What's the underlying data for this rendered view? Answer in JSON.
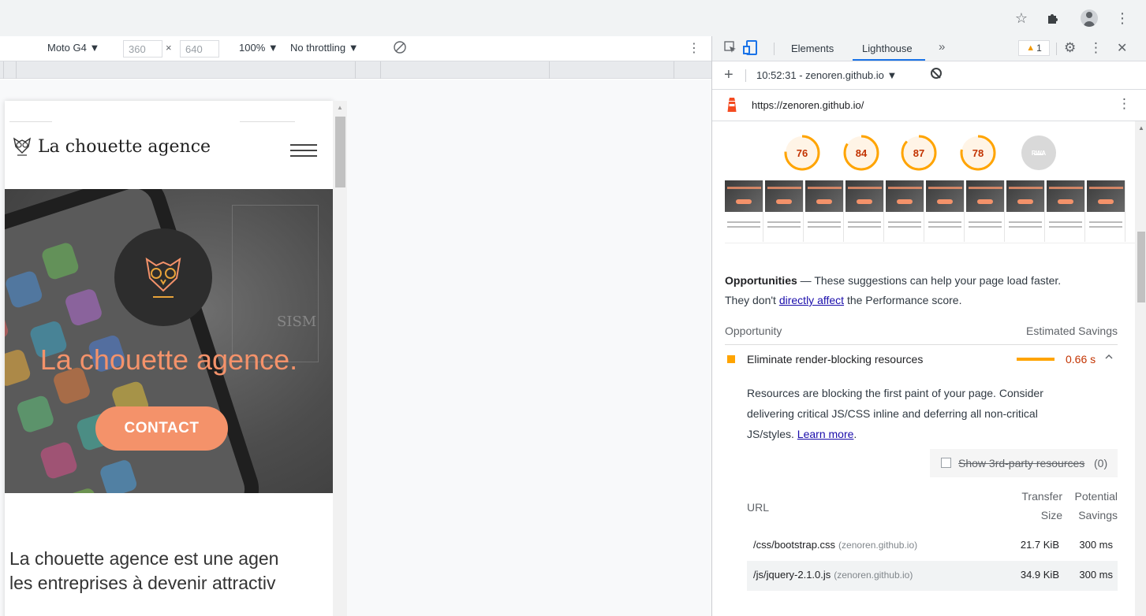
{
  "browser": {
    "icons": [
      "star-icon",
      "puzzle-icon",
      "profile-icon",
      "more-vert-icon"
    ]
  },
  "device_toolbar": {
    "device": "Moto G4 ▼",
    "width": "360",
    "times": "×",
    "height": "640",
    "zoom": "100% ▼",
    "throttling": "No throttling ▼"
  },
  "site": {
    "logo_text": "La chouette agence",
    "hero_title": "La chouette agence.",
    "hero_sketch_text": "SISM",
    "contact_label": "CONTACT",
    "intro_line1": "La chouette agence est une agen",
    "intro_line2": " les entreprises à devenir attractiv",
    "brand_color": "#f4926a"
  },
  "devtools": {
    "tabs": {
      "elements": "Elements",
      "lighthouse": "Lighthouse",
      "more": "»"
    },
    "warning_count": "1",
    "report_select": "10:52:31 - zenoren.github.io ▼",
    "report_url": "https://zenoren.github.io/",
    "scores": [
      {
        "label": "76",
        "value": 76
      },
      {
        "label": "84",
        "value": 84
      },
      {
        "label": "87",
        "value": 87
      },
      {
        "label": "78",
        "value": 78
      },
      {
        "label": "PWA",
        "value": null
      }
    ],
    "score_color": "#ffa400",
    "opportunities": {
      "title": "Opportunities",
      "dash": " — ",
      "text1": "These suggestions can help your page load faster.",
      "text2": "They don't ",
      "link": "directly affect",
      "text3": " the Performance score.",
      "col_opportunity": "Opportunity",
      "col_savings": "Estimated Savings"
    },
    "audit": {
      "title": "Eliminate render-blocking resources",
      "savings": "0.66 s",
      "chevron": "^",
      "desc1": "Resources are blocking the first paint of your page. Consider delivering critical JS/CSS inline and deferring all non-critical JS/styles. ",
      "learn_more": "Learn more",
      "period": ".",
      "thirdparty_label": "Show 3rd-party resources",
      "thirdparty_count": "(0)"
    },
    "table": {
      "col_url": "URL",
      "col_transfer_1": "Transfer",
      "col_transfer_2": "Size",
      "col_savings_1": "Potential",
      "col_savings_2": "Savings",
      "rows": [
        {
          "url": "/css/bootstrap.css",
          "host": "(zenoren.github.io)",
          "size": "21.7 KiB",
          "savings": "300 ms"
        },
        {
          "url": "/js/jquery-2.1.0.js",
          "host": "(zenoren.github.io)",
          "size": "34.9 KiB",
          "savings": "300 ms"
        }
      ]
    }
  }
}
